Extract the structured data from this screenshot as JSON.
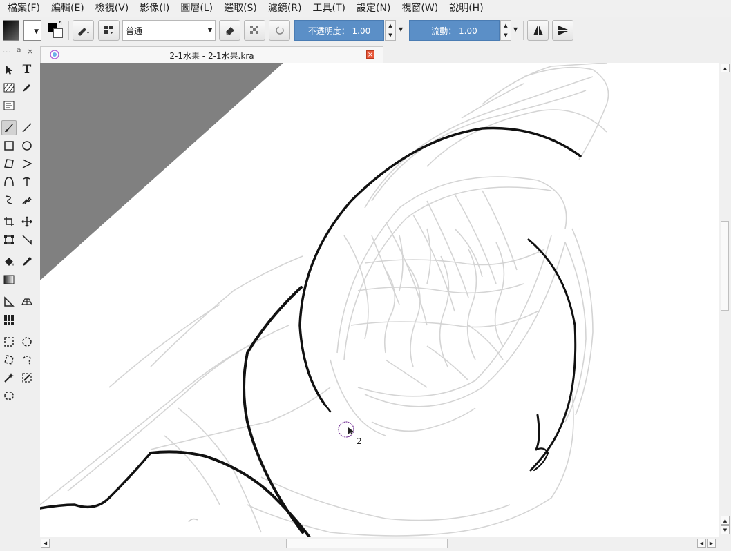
{
  "menu": [
    "檔案(F)",
    "編輯(E)",
    "檢視(V)",
    "影像(I)",
    "圖層(L)",
    "選取(S)",
    "濾鏡(R)",
    "工具(T)",
    "設定(N)",
    "視窗(W)",
    "說明(H)"
  ],
  "toolbar": {
    "blend_mode": "普通",
    "opacity_label": "不透明度： 1.00",
    "flow_label": "流動： 1.00",
    "icons": [
      "gradient-swatch-icon",
      "pattern-swatch-icon",
      "fg-bg-color-icon",
      "brush-preset-icon",
      "workspace-icon",
      "eraser-icon",
      "alpha-lock-icon",
      "reload-preset-icon",
      "mirror-horizontal-icon",
      "mirror-vertical-icon"
    ]
  },
  "document": {
    "tab_title": "2-1水果 - 2-1水果.kra",
    "close_glyph": "×"
  },
  "toolbox": {
    "header": "...",
    "tools": [
      "select-shapes",
      "text",
      "pattern-edit",
      "calligraphy",
      "reference-images",
      "freehand-brush",
      "line",
      "rectangle",
      "ellipse",
      "polygon",
      "polyline",
      "bezier-curve",
      "freehand-path",
      "dynamic-brush",
      "multibrush",
      "crop",
      "move",
      "transform",
      "measure",
      "fill",
      "color-picker",
      "gradient",
      "assistant",
      "perspective-grid",
      "grid",
      "rect-select",
      "ellipse-select",
      "polygon-select",
      "freehand-select",
      "contiguous-select",
      "similar-select",
      "bezier-select"
    ]
  },
  "colors": {
    "accent": "#5b8fc7",
    "canvas_bg": "#ffffff",
    "gray_area": "#808080",
    "ink": "#111111",
    "sketch": "#d6d6d6",
    "close": "#e8583a"
  },
  "cursor_label": "2"
}
